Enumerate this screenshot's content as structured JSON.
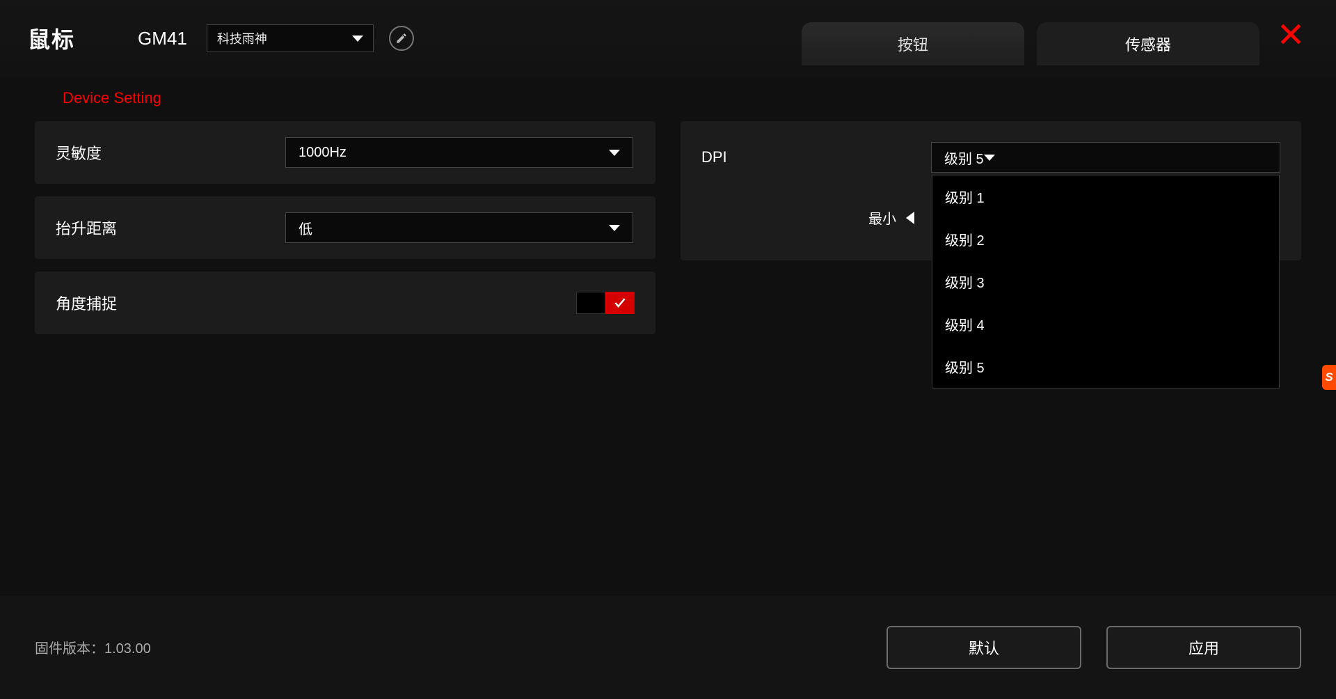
{
  "header": {
    "title": "鼠标",
    "model": "GM41",
    "profile_selected": "科技雨神",
    "tabs": {
      "button": "按钮",
      "sensor": "传感器"
    }
  },
  "section_title": "Device Setting",
  "settings": {
    "polling_label": "灵敏度",
    "polling_value": "1000Hz",
    "lod_label": "抬升距离",
    "lod_value": "低",
    "angle_label": "角度捕捉"
  },
  "dpi": {
    "label": "DPI",
    "selected": "级别 5",
    "min_label": "最小",
    "options": [
      "级别 1",
      "级别 2",
      "级别 3",
      "级别 4",
      "级别 5"
    ]
  },
  "footer": {
    "firmware": "固件版本：1.03.00",
    "default_btn": "默认",
    "apply_btn": "应用"
  },
  "side_tab": "S"
}
